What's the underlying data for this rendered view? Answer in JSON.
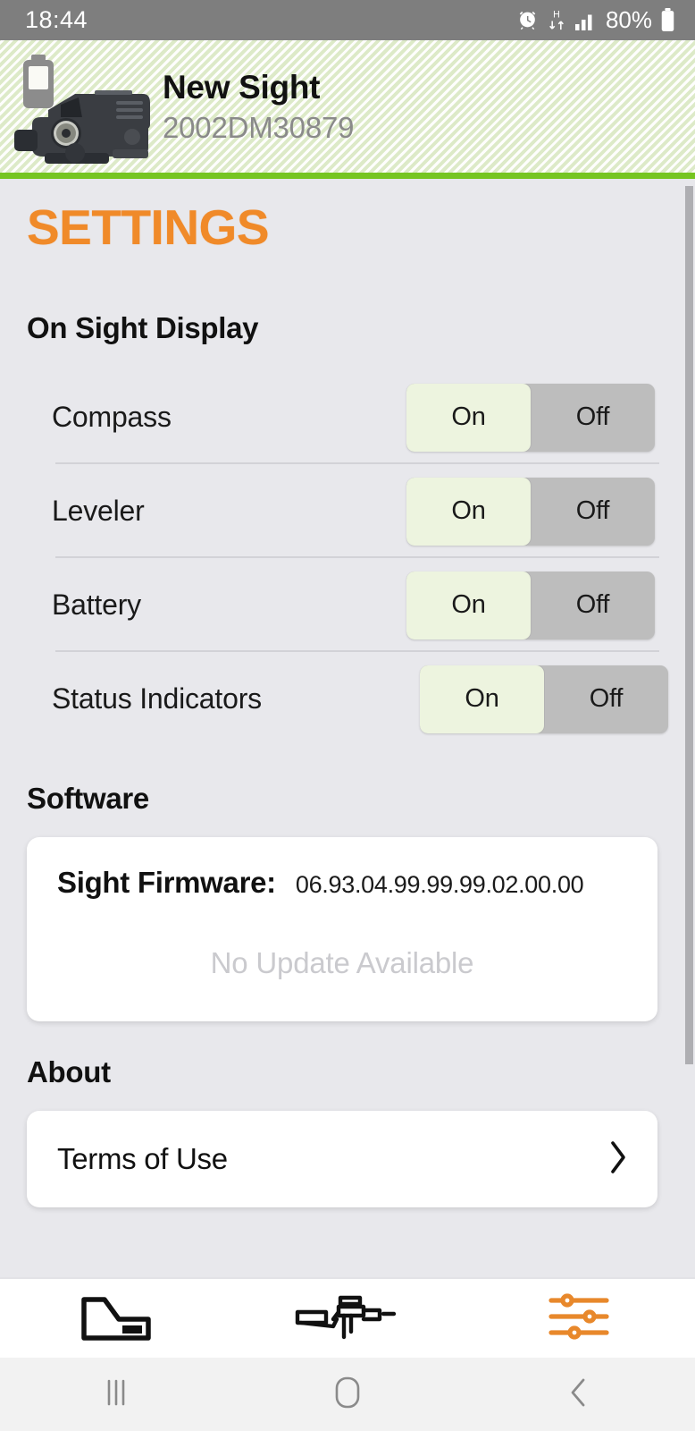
{
  "status_bar": {
    "time": "18:44",
    "battery_percent": "80%",
    "icons": [
      "alarm-icon",
      "hspa-data-icon",
      "signal-bars-icon",
      "battery-icon"
    ]
  },
  "device_header": {
    "name": "New Sight",
    "serial": "2002DM30879",
    "battery_icon": "battery-icon",
    "device_image": "holographic-sight-image",
    "accent_border": "#76C522"
  },
  "page": {
    "title": "SETTINGS",
    "title_color": "#F08A29",
    "background": "#E8E8EC"
  },
  "on_sight_display": {
    "heading": "On Sight Display",
    "options": [
      {
        "label": "Compass",
        "on_label": "On",
        "off_label": "Off",
        "value": "On"
      },
      {
        "label": "Leveler",
        "on_label": "On",
        "off_label": "Off",
        "value": "On"
      },
      {
        "label": "Battery",
        "on_label": "On",
        "off_label": "Off",
        "value": "On"
      },
      {
        "label": "Status Indicators",
        "on_label": "On",
        "off_label": "Off",
        "value": "On"
      }
    ]
  },
  "software": {
    "heading": "Software",
    "firmware_label": "Sight Firmware:",
    "firmware_version": "06.93.04.99.99.99.02.00.00",
    "update_status": "No Update Available"
  },
  "about": {
    "heading": "About",
    "items": [
      {
        "label": "Terms of Use",
        "chevron": "chevron-right-icon"
      }
    ]
  },
  "tab_bar": {
    "tabs": [
      {
        "name": "sight-tab",
        "icon": "sight-icon",
        "active": false
      },
      {
        "name": "firearm-tab",
        "icon": "rifle-icon",
        "active": false
      },
      {
        "name": "settings-tab",
        "icon": "sliders-icon",
        "active": true
      }
    ],
    "active_color": "#E8882B",
    "inactive_color": "#111111"
  },
  "android_nav": {
    "buttons": [
      {
        "name": "recents-button",
        "icon": "recents-icon"
      },
      {
        "name": "home-button",
        "icon": "home-icon"
      },
      {
        "name": "back-button",
        "icon": "back-chevron-icon"
      }
    ]
  }
}
